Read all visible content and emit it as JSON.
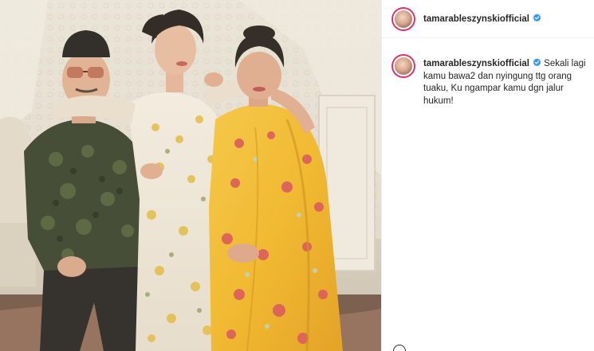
{
  "post": {
    "username": "tamarableszynskiofficial",
    "verified": true,
    "caption": {
      "username": "tamarableszynskiofficial",
      "text": "Sekali lagi kamu bawa2 dan nyingung ttg orang tuaku, Ku ngampar kamu dgn jalur hukum!"
    }
  },
  "icons": {
    "verified": "verified-badge-icon",
    "bottom": "heart-icon"
  },
  "colors": {
    "verified_blue": "#3897f0",
    "story_ring": "#e1306c",
    "text": "#262626"
  }
}
